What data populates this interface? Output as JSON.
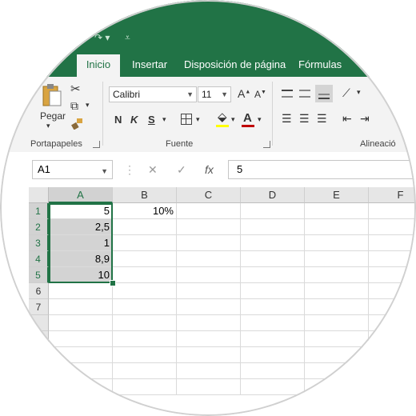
{
  "ribbon_tabs": [
    "Inicio",
    "Insertar",
    "Disposición de página",
    "Fórmulas"
  ],
  "quick_access": {
    "undo_glyph": "↷ ▾",
    "customize_glyph": "⩡"
  },
  "clipboard": {
    "paste_label": "Pegar",
    "group_label": "Portapapeles"
  },
  "font": {
    "name": "Calibri",
    "size": "11",
    "grow": "A",
    "shrink": "A",
    "bold": "N",
    "italic": "K",
    "underline": "S",
    "fill_glyph": "⬙",
    "color_glyph": "A",
    "group_label": "Fuente",
    "accent_color": "#c00000"
  },
  "alignment": {
    "group_label": "Alineació"
  },
  "formula_bar": {
    "name_box": "A1",
    "cancel": "✕",
    "enter": "✓",
    "fx": "fx",
    "value": "5"
  },
  "columns": [
    "A",
    "B",
    "C",
    "D",
    "E",
    "F"
  ],
  "rows": [
    "1",
    "2",
    "3",
    "4",
    "5",
    "6",
    "7",
    "",
    "",
    "",
    "",
    ""
  ],
  "cells": {
    "A1": "5",
    "A2": "2,5",
    "A3": "1",
    "A4": "8,9",
    "A5": "10",
    "B1": "10%"
  },
  "colors": {
    "excel_green": "#217346",
    "ribbon_bg": "#f3f3f3",
    "selection_fill": "#d3d3d3"
  }
}
